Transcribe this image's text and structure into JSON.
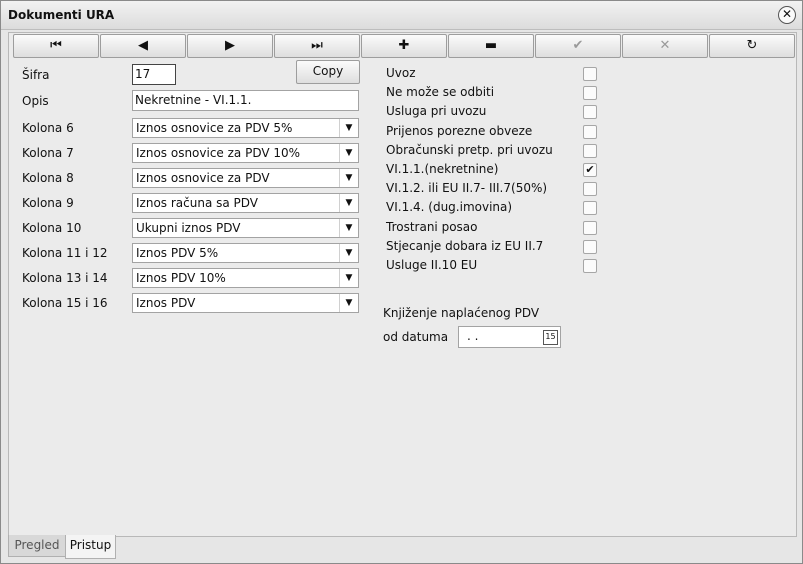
{
  "window": {
    "title": "Dokumenti URA",
    "close": "✕"
  },
  "toolbar": {
    "first": "⏮",
    "prev": "◀",
    "next": "▶",
    "last": "⏭",
    "add": "✚",
    "remove": "▬",
    "confirm": "✔",
    "cancel": "✕",
    "refresh": "↻"
  },
  "form": {
    "sifra_label": "Šifra",
    "sifra_value": "17",
    "copy_label": "Copy",
    "opis_label": "Opis",
    "opis_value": "Nekretnine - VI.1.1.",
    "kolone": [
      {
        "label": "Kolona 6",
        "value": "Iznos osnovice za PDV 5%"
      },
      {
        "label": "Kolona 7",
        "value": "Iznos osnovice za PDV 10%"
      },
      {
        "label": "Kolona 8",
        "value": "Iznos osnovice za PDV"
      },
      {
        "label": "Kolona 9",
        "value": "Iznos računa sa PDV"
      },
      {
        "label": "Kolona 10",
        "value": "Ukupni iznos PDV"
      },
      {
        "label": "Kolona 11 i 12",
        "value": "Iznos PDV 5%"
      },
      {
        "label": "Kolona 13 i 14",
        "value": "Iznos PDV 10%"
      },
      {
        "label": "Kolona 15 i 16",
        "value": "Iznos PDV"
      }
    ]
  },
  "options": [
    {
      "label": "Uvoz",
      "checked": false
    },
    {
      "label": "Ne može se odbiti",
      "checked": false
    },
    {
      "label": "Usluga pri uvozu",
      "checked": false
    },
    {
      "label": "Prijenos porezne obveze",
      "checked": false
    },
    {
      "label": "Obračunski pretp. pri uvozu",
      "checked": false
    },
    {
      "label": "VI.1.1.(nekretnine)",
      "checked": true
    },
    {
      "label": "VI.1.2.  ili EU II.7- III.7(50%)",
      "checked": false
    },
    {
      "label": "VI.1.4. (dug.imovina)",
      "checked": false
    },
    {
      "label": "Trostrani posao",
      "checked": false
    },
    {
      "label": "Stjecanje dobara iz EU II.7",
      "checked": false
    },
    {
      "label": "Usluge II.10 EU",
      "checked": false
    }
  ],
  "knjizenje": {
    "title": "Knjiženje naplaćenog PDV",
    "od_datuma_label": "od datuma",
    "od_datuma_value": " .  .",
    "calendar_icon": "15"
  },
  "tabs": [
    {
      "label": "Pregled",
      "active": false
    },
    {
      "label": "Pristup",
      "active": true
    }
  ]
}
